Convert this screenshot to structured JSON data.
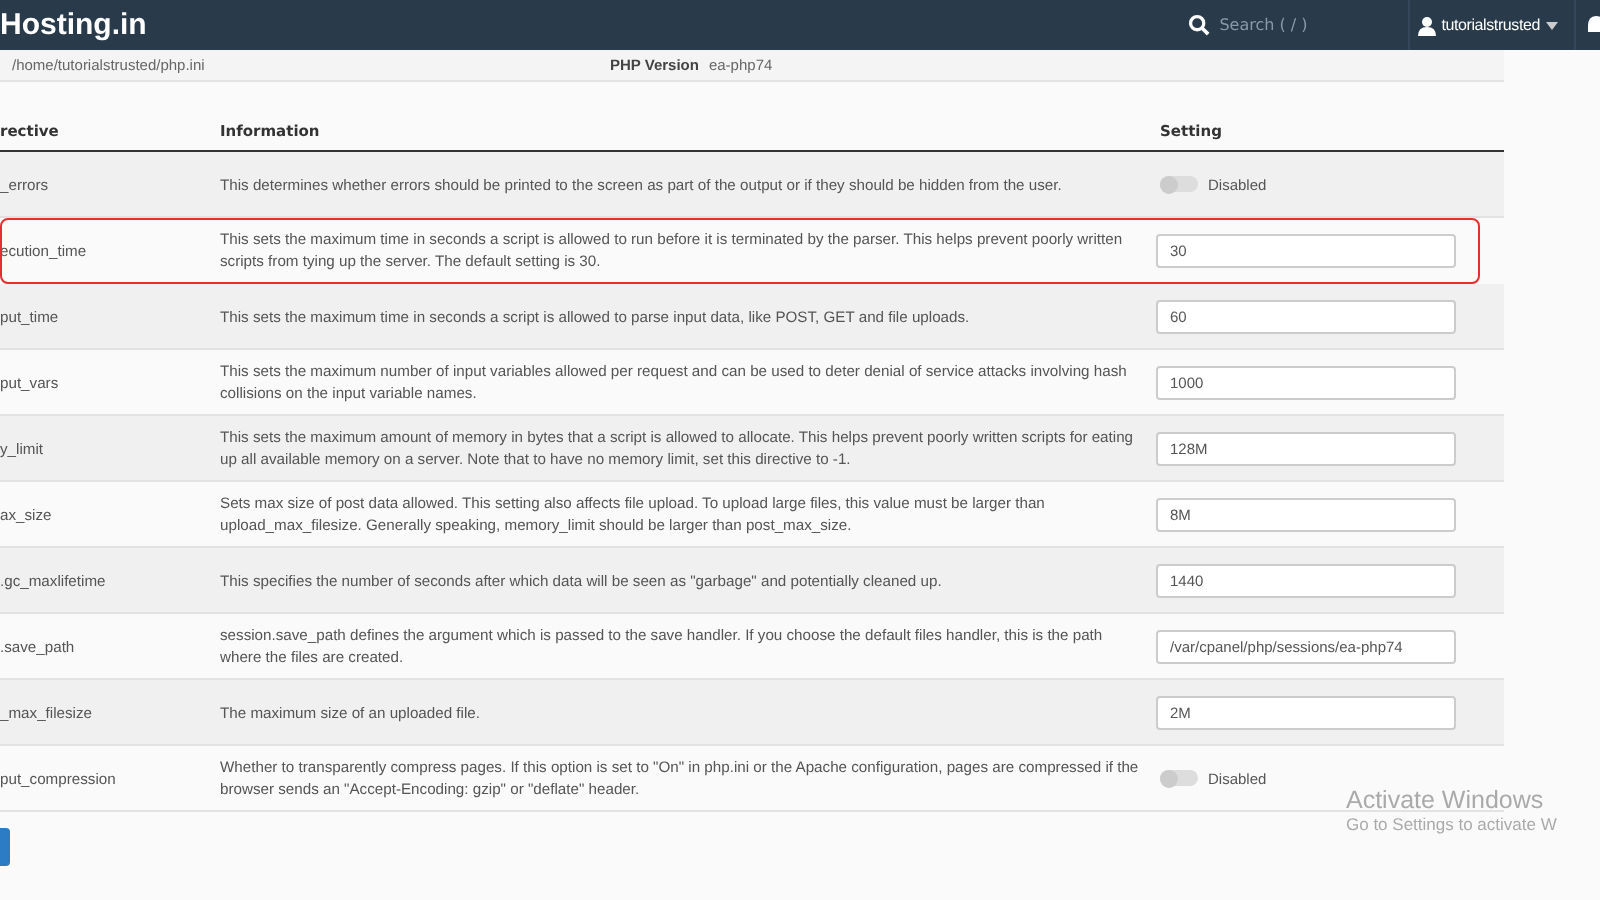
{
  "header": {
    "logo": "Hosting.in",
    "search": {
      "placeholder": "Search ( / )"
    },
    "user": "tutorialstrusted"
  },
  "path_bar": {
    "path": "/home/tutorialstrusted/php.ini",
    "version_label": "PHP Version",
    "version": "ea-php74"
  },
  "table": {
    "columns": [
      "rective",
      "Information",
      "Setting"
    ],
    "rows": [
      {
        "directive": "_errors",
        "info": "This determines whether errors should be printed to the screen as part of the output or if they should be hidden from the user.",
        "kind": "toggle",
        "on": false,
        "value": "Disabled",
        "highlighted": false
      },
      {
        "directive": "ecution_time",
        "info": "This sets the maximum time in seconds a script is allowed to run before it is terminated by the parser. This helps prevent poorly written scripts from tying up the server. The default setting is 30.",
        "kind": "input",
        "value": "30",
        "highlighted": true
      },
      {
        "directive": "put_time",
        "info": "This sets the maximum time in seconds a script is allowed to parse input data, like POST, GET and file uploads.",
        "kind": "input",
        "value": "60",
        "highlighted": false
      },
      {
        "directive": "put_vars",
        "info": "This sets the maximum number of input variables allowed per request and can be used to deter denial of service attacks involving hash collisions on the input variable names.",
        "kind": "input",
        "value": "1000",
        "highlighted": false
      },
      {
        "directive": "y_limit",
        "info": "This sets the maximum amount of memory in bytes that a script is allowed to allocate. This helps prevent poorly written scripts for eating up all available memory on a server. Note that to have no memory limit, set this directive to -1.",
        "kind": "input",
        "value": "128M",
        "highlighted": false
      },
      {
        "directive": "ax_size",
        "info": "Sets max size of post data allowed. This setting also affects file upload. To upload large files, this value must be larger than upload_max_filesize. Generally speaking, memory_limit should be larger than post_max_size.",
        "kind": "input",
        "value": "8M",
        "highlighted": false
      },
      {
        "directive": ".gc_maxlifetime",
        "info": "This specifies the number of seconds after which data will be seen as \"garbage\" and potentially cleaned up.",
        "kind": "input",
        "value": "1440",
        "highlighted": false
      },
      {
        "directive": ".save_path",
        "info": "session.save_path defines the argument which is passed to the save handler. If you choose the default files handler, this is the path where the files are created.",
        "kind": "input",
        "value": "/var/cpanel/php/sessions/ea-php74",
        "highlighted": false
      },
      {
        "directive": "_max_filesize",
        "info": "The maximum size of an uploaded file.",
        "kind": "input",
        "value": "2M",
        "highlighted": false
      },
      {
        "directive": "put_compression",
        "info": "Whether to transparently compress pages. If this option is set to \"On\" in php.ini or the Apache configuration, pages are compressed if the browser sends an \"Accept-Encoding: gzip\" or \"deflate\" header.",
        "kind": "toggle",
        "on": false,
        "value": "Disabled",
        "highlighted": false
      }
    ]
  },
  "os_notice": {
    "title": "Activate Windows",
    "text": "Go to Settings to activate W"
  }
}
